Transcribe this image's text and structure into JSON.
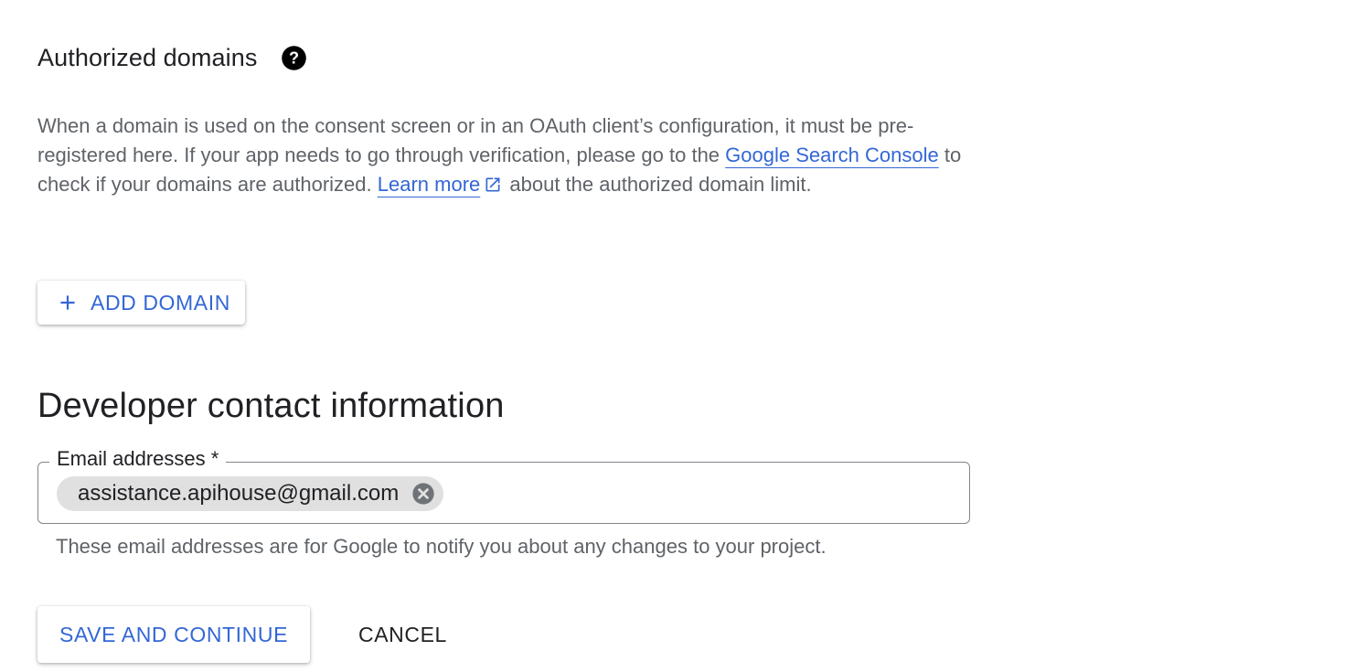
{
  "authorized_domains": {
    "title": "Authorized domains",
    "help_icon": "help-circle-icon",
    "description": {
      "part1": "When a domain is used on the consent screen or in an OAuth client’s configuration, it must be pre-registered here. If your app needs to go through verification, please go to the ",
      "link_search_console": "Google Search Console",
      "part2": " to check if your domains are authorized. ",
      "link_learn_more": "Learn more",
      "part3": " about the authorized domain limit."
    },
    "add_domain_label": "ADD DOMAIN",
    "add_icon": "plus-icon"
  },
  "developer_contact": {
    "title": "Developer contact information",
    "email_field": {
      "label": "Email addresses *",
      "chips": [
        "assistance.apihouse@gmail.com"
      ],
      "remove_icon": "cancel-circle-icon",
      "helper_text": "These email addresses are for Google to notify you about any changes to your project."
    }
  },
  "actions": {
    "save_label": "SAVE AND CONTINUE",
    "cancel_label": "CANCEL"
  },
  "colors": {
    "accent": "#3367d6",
    "text_primary": "#202124",
    "text_secondary": "#5f6368",
    "chip_background": "#e0e0e0"
  }
}
